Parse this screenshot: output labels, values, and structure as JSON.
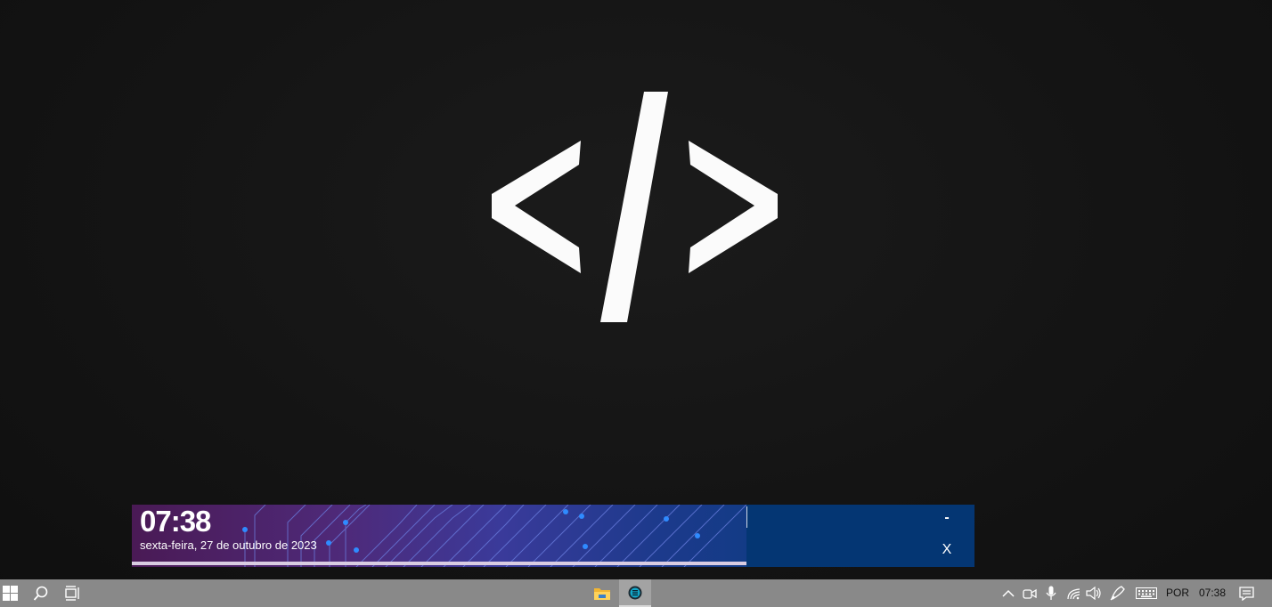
{
  "widget": {
    "time": "07:38",
    "date": "sexta-feira, 27 de outubro de 2023",
    "minimize_label": "-",
    "close_label": "X"
  },
  "taskbar": {
    "language": "POR",
    "clock": "07:38",
    "icons": [
      "windows-start-icon",
      "search-icon",
      "task-view-icon",
      "file-explorer-icon",
      "app-icon",
      "chevron-up-icon",
      "camera-icon",
      "microphone-icon",
      "wifi-icon",
      "volume-icon",
      "pen-icon",
      "keyboard-icon",
      "notifications-icon"
    ]
  }
}
